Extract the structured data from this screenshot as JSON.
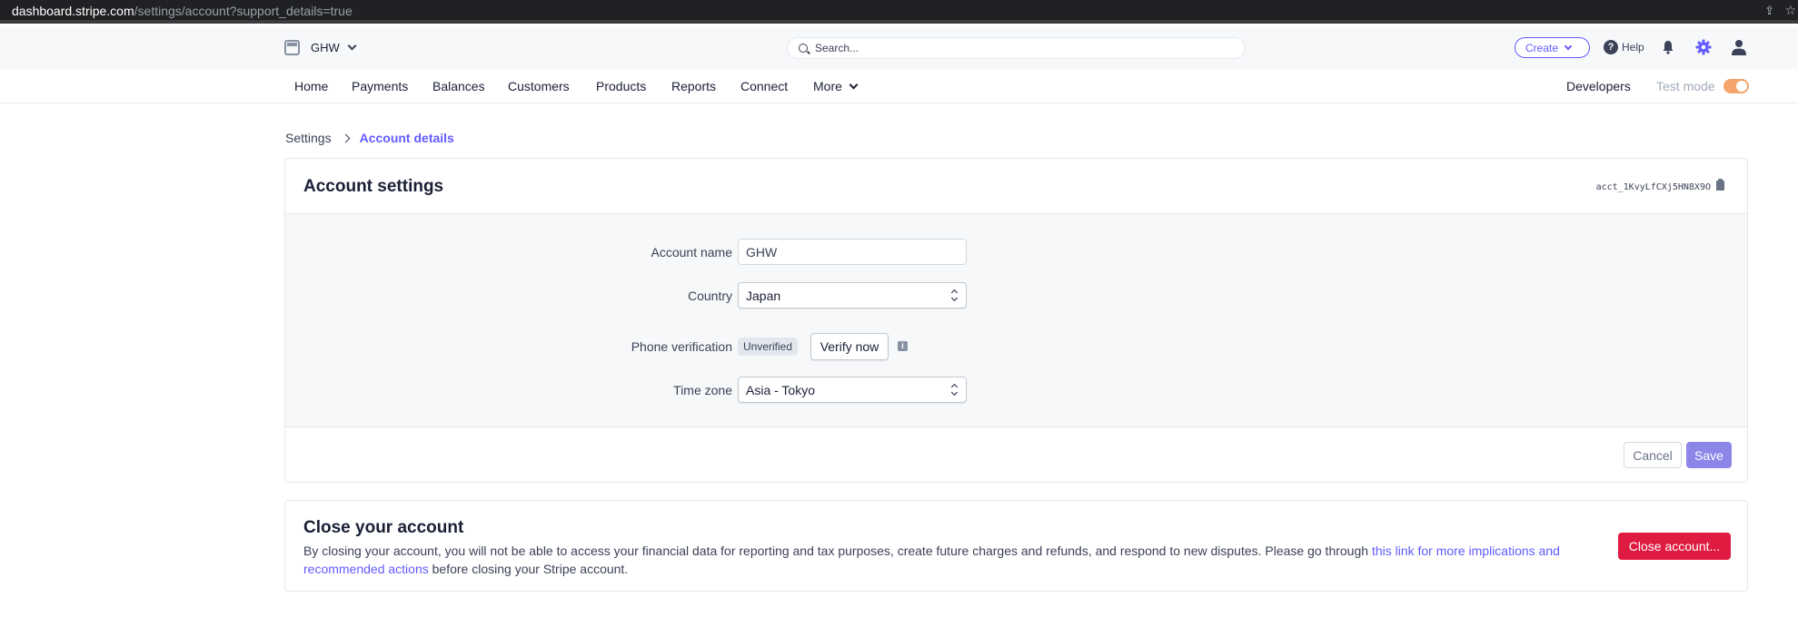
{
  "browser": {
    "url_host": "dashboard.stripe.com",
    "url_path": "/settings/account?support_details=true",
    "share_icon": "share-icon",
    "star_icon": "star-icon"
  },
  "topbar": {
    "account_name": "GHW",
    "search_placeholder": "Search...",
    "create_label": "Create",
    "help_label": "Help",
    "icons": [
      "bell-icon",
      "gear-icon",
      "user-icon"
    ],
    "accent_color": "#635bff"
  },
  "nav": {
    "items": [
      "Home",
      "Payments",
      "Balances",
      "Customers",
      "Products",
      "Reports",
      "Connect",
      "More"
    ],
    "developers": "Developers",
    "test_mode": "Test mode",
    "test_mode_on": true
  },
  "breadcrumb": {
    "parent": "Settings",
    "current": "Account details"
  },
  "account_settings": {
    "title": "Account settings",
    "account_id": "acct_1KvyLfCXj5HN8X9O",
    "fields": {
      "account_name_label": "Account name",
      "account_name_value": "GHW",
      "country_label": "Country",
      "country_value": "Japan",
      "phone_label": "Phone verification",
      "phone_status": "Unverified",
      "verify_label": "Verify now",
      "timezone_label": "Time zone",
      "timezone_value": "Asia - Tokyo"
    },
    "cancel_label": "Cancel",
    "save_label": "Save"
  },
  "close_account": {
    "title": "Close your account",
    "text_before": "By closing your account, you will not be able to access your financial data for reporting and tax purposes, create future charges and refunds, and respond to new disputes. Please go through ",
    "link_text": "this link for more implications and recommended actions",
    "text_after": " before closing your Stripe account.",
    "button_label": "Close account...",
    "button_color": "#df1b41"
  }
}
